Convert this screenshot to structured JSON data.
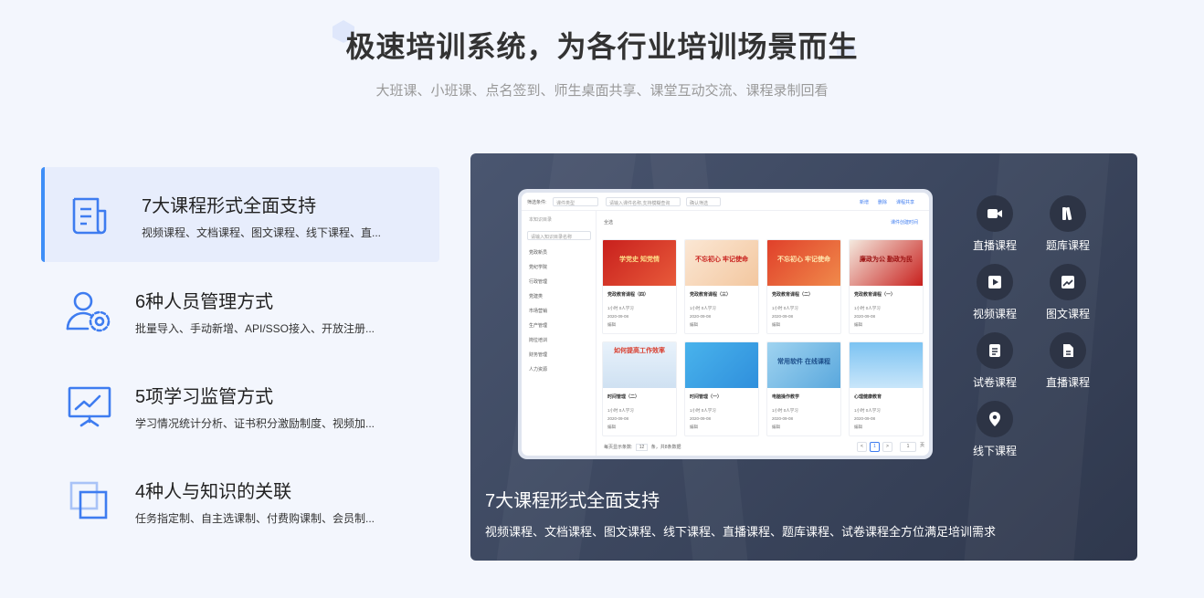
{
  "header": {
    "title": "极速培训系统，为各行业培训场景而生",
    "subtitle": "大班课、小班课、点名签到、师生桌面共享、课堂互动交流、课程录制回看"
  },
  "features": [
    {
      "icon": "document-icon",
      "title": "7大课程形式全面支持",
      "desc": "视频课程、文档课程、图文课程、线下课程、直..."
    },
    {
      "icon": "user-settings-icon",
      "title": "6种人员管理方式",
      "desc": "批量导入、手动新增、API/SSO接入、开放注册..."
    },
    {
      "icon": "monitor-chart-icon",
      "title": "5项学习监管方式",
      "desc": "学习情况统计分析、证书积分激励制度、视频加..."
    },
    {
      "icon": "overlap-squares-icon",
      "title": "4种人与知识的关联",
      "desc": "任务指定制、自主选课制、付费购课制、会员制..."
    }
  ],
  "panel": {
    "title": "7大课程形式全面支持",
    "desc": "视频课程、文档课程、图文课程、线下课程、直播课程、题库课程、试卷课程全方位满足培训需求",
    "course_types": [
      {
        "icon": "video-camera-icon",
        "label": "直播课程"
      },
      {
        "icon": "question-bank-icon",
        "label": "题库课程"
      },
      {
        "icon": "play-icon",
        "label": "视频课程"
      },
      {
        "icon": "image-icon",
        "label": "图文课程"
      },
      {
        "icon": "exam-paper-icon",
        "label": "试卷课程"
      },
      {
        "icon": "live-doc-icon",
        "label": "直播课程"
      },
      {
        "icon": "location-pin-icon",
        "label": "线下课程"
      }
    ]
  },
  "mock": {
    "filter_label": "筛选条件:",
    "filter_select": "课件类型",
    "search_placeholder": "请输入课件名称,支持模糊查询",
    "search_button": "确认筛选",
    "actions": [
      "新增",
      "删除",
      "课程共享"
    ],
    "sidebar_header": "本知识目录",
    "sidebar_search": "请输入知识目录名称",
    "sidebar_items": [
      "党政新员",
      "党纪学院",
      "行政管理",
      "党建类",
      "市场营销",
      "生产管理",
      "岗位培训",
      "财务管理",
      "人力资源"
    ],
    "select_all": "全选",
    "sort_label": "课件创建时间",
    "cards": [
      {
        "thumb": "学党史 知党情",
        "title": "党政教育课程（四）",
        "learners": "1小时 0人学习",
        "date": "2020-09-08",
        "status": "课程",
        "edit": "编辑",
        "del": "删除"
      },
      {
        "thumb": "不忘初心 牢记使命",
        "title": "党政教育课程（三）",
        "learners": "1小时 0人学习",
        "date": "2020-09-08",
        "status": "课程",
        "edit": "编辑",
        "del": "删除"
      },
      {
        "thumb": "不忘初心 牢记使命",
        "title": "党政教育课程（二）",
        "learners": "1小时 0人学习",
        "date": "2020-09-08",
        "status": "课程",
        "edit": "编辑",
        "del": "删除"
      },
      {
        "thumb": "廉政为公 勤政为民",
        "title": "党政教育课程（一）",
        "learners": "1小时 0人学习",
        "date": "2020-09-08",
        "status": "课程",
        "edit": "编辑",
        "del": "删除"
      },
      {
        "thumb": "如何提高工作效率",
        "title": "时间管理（二）",
        "learners": "1小时 0人学习",
        "date": "2020-09-08",
        "status": "课程",
        "edit": "编辑",
        "del": "删除"
      },
      {
        "thumb": "",
        "title": "时间管理（一）",
        "learners": "1小时 0人学习",
        "date": "2020-09-08",
        "status": "课程",
        "edit": "编辑",
        "del": "删除"
      },
      {
        "thumb": "常用软件 在线课程",
        "title": "电脑操作教学",
        "learners": "1小时 0人学习",
        "date": "2020-09-08",
        "status": "课程",
        "edit": "编辑",
        "del": "删除"
      },
      {
        "thumb": "",
        "title": "心理健康教育",
        "learners": "1小时 0人学习",
        "date": "2020-09-08",
        "status": "课程",
        "edit": "编辑",
        "del": "删除"
      }
    ],
    "footer": "每页显示条数:",
    "page_size": "12",
    "footer_tail": "条，共8条数据",
    "page_prev": "<",
    "page_current": "1",
    "page_next": ">",
    "goto_value": "1",
    "goto_suffix": "页"
  }
}
